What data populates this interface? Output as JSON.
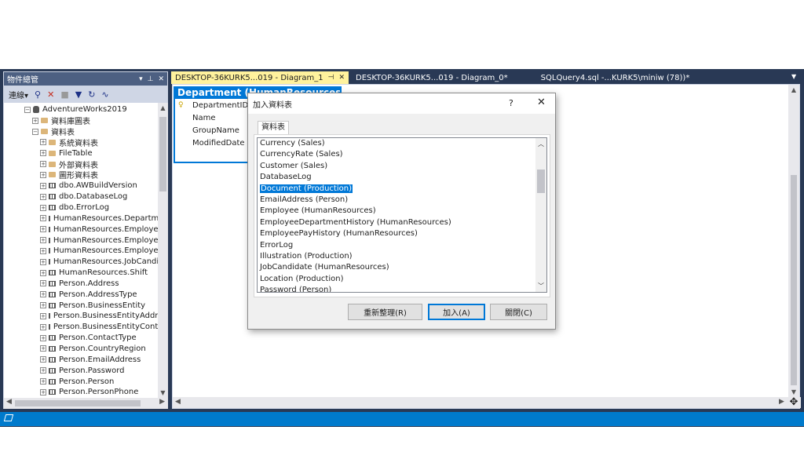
{
  "object_explorer": {
    "title": "物件總管",
    "controls": [
      "▾",
      "⊥",
      "✕"
    ],
    "toolbar": {
      "connect_label": "連線"
    },
    "tree": [
      {
        "level": 0,
        "expander": "−",
        "icon": "database",
        "label": "AdventureWorks2019"
      },
      {
        "level": 1,
        "expander": "+",
        "icon": "folder",
        "label": "資料庫圖表"
      },
      {
        "level": 1,
        "expander": "−",
        "icon": "folder",
        "label": "資料表"
      },
      {
        "level": 2,
        "expander": "+",
        "icon": "folder",
        "label": "系統資料表"
      },
      {
        "level": 2,
        "expander": "+",
        "icon": "folder",
        "label": "FileTable"
      },
      {
        "level": 2,
        "expander": "+",
        "icon": "folder",
        "label": "外部資料表"
      },
      {
        "level": 2,
        "expander": "+",
        "icon": "folder",
        "label": "圖形資料表"
      },
      {
        "level": 2,
        "expander": "+",
        "icon": "table",
        "label": "dbo.AWBuildVersion"
      },
      {
        "level": 2,
        "expander": "+",
        "icon": "table",
        "label": "dbo.DatabaseLog"
      },
      {
        "level": 2,
        "expander": "+",
        "icon": "table",
        "label": "dbo.ErrorLog"
      },
      {
        "level": 2,
        "expander": "+",
        "icon": "table",
        "label": "HumanResources.Departme"
      },
      {
        "level": 2,
        "expander": "+",
        "icon": "table",
        "label": "HumanResources.Employee"
      },
      {
        "level": 2,
        "expander": "+",
        "icon": "table",
        "label": "HumanResources.EmployeeI"
      },
      {
        "level": 2,
        "expander": "+",
        "icon": "table",
        "label": "HumanResources.EmployeeI"
      },
      {
        "level": 2,
        "expander": "+",
        "icon": "table",
        "label": "HumanResources.JobCandid"
      },
      {
        "level": 2,
        "expander": "+",
        "icon": "table",
        "label": "HumanResources.Shift"
      },
      {
        "level": 2,
        "expander": "+",
        "icon": "table",
        "label": "Person.Address"
      },
      {
        "level": 2,
        "expander": "+",
        "icon": "table",
        "label": "Person.AddressType"
      },
      {
        "level": 2,
        "expander": "+",
        "icon": "table",
        "label": "Person.BusinessEntity"
      },
      {
        "level": 2,
        "expander": "+",
        "icon": "table",
        "label": "Person.BusinessEntityAddres"
      },
      {
        "level": 2,
        "expander": "+",
        "icon": "table",
        "label": "Person.BusinessEntityContac"
      },
      {
        "level": 2,
        "expander": "+",
        "icon": "table",
        "label": "Person.ContactType"
      },
      {
        "level": 2,
        "expander": "+",
        "icon": "table",
        "label": "Person.CountryRegion"
      },
      {
        "level": 2,
        "expander": "+",
        "icon": "table",
        "label": "Person.EmailAddress"
      },
      {
        "level": 2,
        "expander": "+",
        "icon": "table",
        "label": "Person.Password"
      },
      {
        "level": 2,
        "expander": "+",
        "icon": "table",
        "label": "Person.Person"
      },
      {
        "level": 2,
        "expander": "+",
        "icon": "table",
        "label": "Person.PersonPhone"
      }
    ]
  },
  "tabs": [
    {
      "label": "DESKTOP-36KURK5...019 - Diagram_1",
      "active": true,
      "pin": "⊣",
      "close": "✕"
    },
    {
      "label": "DESKTOP-36KURK5...019 - Diagram_0*",
      "active": false
    },
    {
      "label": "SQLQuery4.sql -...KURK5\\miniw (78))*",
      "active": false
    }
  ],
  "diagram_table": {
    "title": "Department (HumanResources)",
    "columns": [
      {
        "name": "DepartmentID",
        "key": true
      },
      {
        "name": "Name",
        "key": false
      },
      {
        "name": "GroupName",
        "key": false
      },
      {
        "name": "ModifiedDate",
        "key": false
      }
    ]
  },
  "dialog": {
    "title": "加入資料表",
    "help": "?",
    "close": "✕",
    "tab_label": "資料表",
    "items": [
      "Currency (Sales)",
      "CurrencyRate (Sales)",
      "Customer (Sales)",
      "DatabaseLog",
      "Document (Production)",
      "EmailAddress (Person)",
      "Employee (HumanResources)",
      "EmployeeDepartmentHistory (HumanResources)",
      "EmployeePayHistory (HumanResources)",
      "ErrorLog",
      "Illustration (Production)",
      "JobCandidate (HumanResources)",
      "Location (Production)",
      "Password (Person)"
    ],
    "selected_item": "Document (Production)",
    "buttons": {
      "refresh": "重新整理(R)",
      "add": "加入(A)",
      "close": "關閉(C)"
    }
  },
  "colors": {
    "frame": "#293955",
    "panel_title": "#4d6082",
    "active_tab": "#fff29d",
    "selection": "#0078d7",
    "status_bar": "#007acc"
  }
}
